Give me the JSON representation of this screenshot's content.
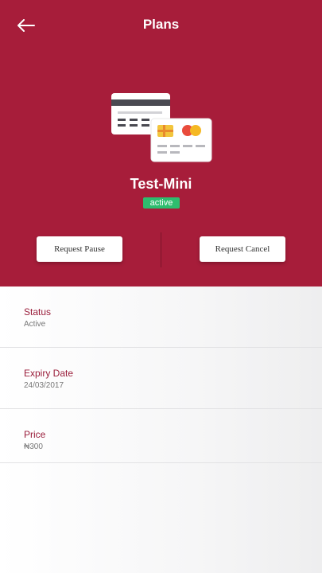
{
  "header": {
    "title": "Plans",
    "back_icon": "arrow-left-icon",
    "background": "#a71d3a"
  },
  "illustration": {
    "icon": "credit-cards-icon"
  },
  "plan": {
    "name": "Test-Mini",
    "status_badge": "active",
    "badge_color": "#2dbd6e"
  },
  "actions": {
    "pause_label": "Request Pause",
    "cancel_label": "Request Cancel"
  },
  "details": [
    {
      "label": "Status",
      "value": "Active"
    },
    {
      "label": "Expiry Date",
      "value": "24/03/2017"
    },
    {
      "label": "Price",
      "value": "₦300"
    }
  ],
  "colors": {
    "accent": "#9a1d3a"
  }
}
